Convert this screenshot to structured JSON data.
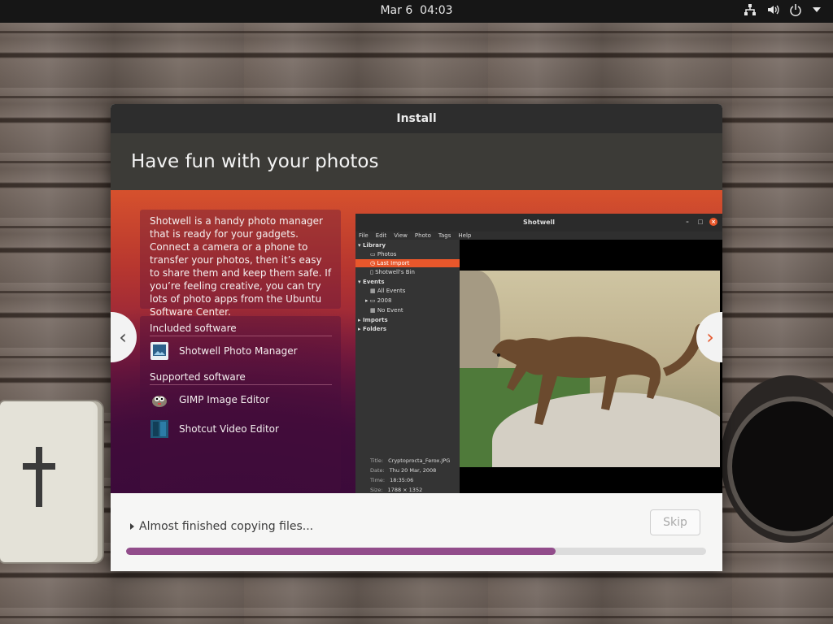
{
  "topbar": {
    "date": "Mar 6",
    "time": "04:03"
  },
  "window": {
    "title": "Install",
    "headline": "Have fun with your photos",
    "description": "Shotwell is a handy photo manager that is ready for your gadgets. Connect a camera or a phone to transfer your photos, then it’s easy to share them and keep them safe. If you’re feeling creative, you can try lots of photo apps from the Ubuntu Software Center.",
    "included_heading": "Included software",
    "included": [
      {
        "name": "Shotwell Photo Manager",
        "icon": "shotwell-icon"
      }
    ],
    "supported_heading": "Supported software",
    "supported": [
      {
        "name": "GIMP Image Editor",
        "icon": "gimp-icon"
      },
      {
        "name": "Shotcut Video Editor",
        "icon": "shotcut-icon"
      }
    ]
  },
  "preview": {
    "title": "Shotwell",
    "menu": [
      "File",
      "Edit",
      "View",
      "Photo",
      "Tags",
      "Help"
    ],
    "tree": {
      "library": "Library",
      "photos": "Photos",
      "last_import": "Last Import",
      "bin": "Shotwell's Bin",
      "events": "Events",
      "all_events": "All Events",
      "year": "2008",
      "no_event": "No Event",
      "imports": "Imports",
      "folders": "Folders"
    },
    "meta": [
      {
        "label": "Title:",
        "value": "Cryptoprocta_Ferox.JPG"
      },
      {
        "label": "Date:",
        "value": "Thu 20 Mar, 2008"
      },
      {
        "label": "Time:",
        "value": "18:35:06"
      },
      {
        "label": "Size:",
        "value": "1788 × 1352"
      }
    ]
  },
  "bottom": {
    "status": "Almost finished copying files...",
    "skip_label": "Skip",
    "progress": 0.74
  },
  "colors": {
    "accent": "#924d8b",
    "orange": "#e9572b"
  }
}
